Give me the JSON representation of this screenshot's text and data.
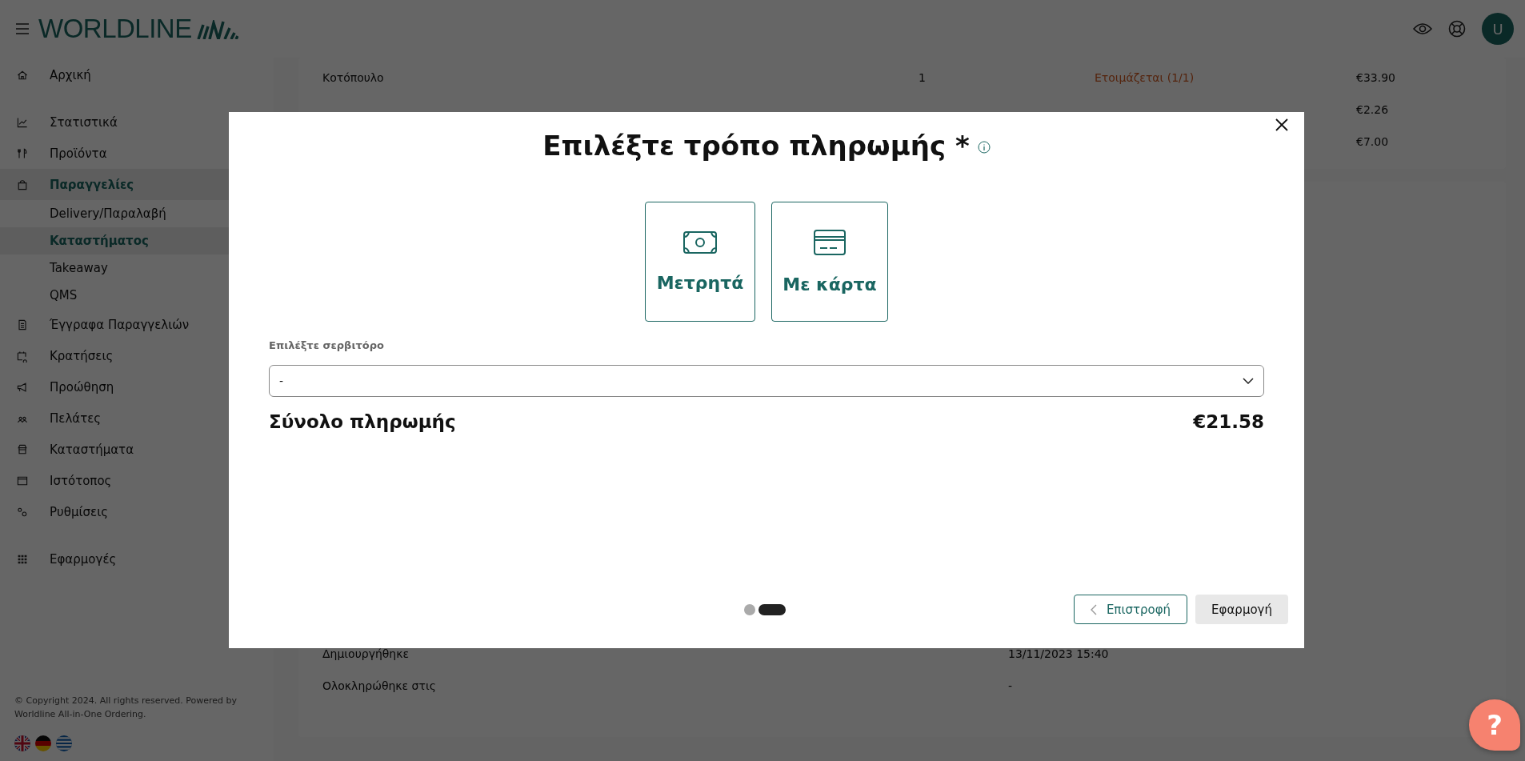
{
  "header": {
    "logo": "**WORLD**LINE",
    "avatar": "U"
  },
  "sidebar": {
    "groups": [
      [
        {
          "label": "Αρχική",
          "selected": false
        }
      ],
      [
        {
          "label": "Στατιστικά",
          "selected": false
        },
        {
          "label": "Προϊόντα",
          "selected": false
        },
        {
          "label": "Παραγγελίες",
          "selected": true,
          "children": [
            {
              "label": "Delivery/Παραλαβή",
              "selected": false
            },
            {
              "label": "Καταστήματος",
              "selected": true
            },
            {
              "label": "Takeaway",
              "selected": false
            },
            {
              "label": "QMS",
              "selected": false
            }
          ]
        },
        {
          "label": "Έγγραφα Παραγγελιών",
          "selected": false
        },
        {
          "label": "Κρατήσεις",
          "selected": false
        },
        {
          "label": "Προώθηση",
          "selected": false
        },
        {
          "label": "Πελάτες",
          "selected": false
        },
        {
          "label": "Καταστήματα",
          "selected": false
        },
        {
          "label": "Ιστότοπος",
          "selected": false
        },
        {
          "label": "Ρυθμίσεις",
          "selected": false
        }
      ],
      [
        {
          "label": "Εφαρμογές",
          "selected": false
        }
      ]
    ],
    "copyright": "© Copyright 2024. All rights reserved. Powered by Worldline All-in-One Ordering."
  },
  "order_items": [
    {
      "name": "Κοτόπουλο",
      "quantity": "1",
      "status": "Ετοιμάζεται (1/1)",
      "price": "€33.90"
    },
    {
      "price": "€2.26"
    },
    {
      "price": "€7.00"
    }
  ],
  "order_details": [
    {
      "label": "Δημιουργήθηκε",
      "value": "13/11/2023 15:40"
    },
    {
      "label": "Ολοκληρώθηκε στις",
      "value": "-"
    }
  ],
  "dialog": {
    "title": "Επιλέξτε τρόπο πληρωμής *",
    "payment_methods": [
      {
        "label": "Μετρητά",
        "selected": false
      },
      {
        "label": "Με κάρτα",
        "selected": false
      }
    ],
    "waiter": {
      "label": "Επιλέξτε σερβιτόρο",
      "value": "-"
    },
    "total": {
      "label": "Σύνολο πληρωμής",
      "value": "€21.58"
    },
    "steps": [
      {
        "selected": false
      },
      {
        "selected": true
      }
    ],
    "buttons": [
      {
        "label": "Επιστροφή",
        "kind": "back"
      },
      {
        "label": "Εφαρμογή",
        "kind": "apply"
      }
    ]
  },
  "help": {
    "label": "?"
  }
}
